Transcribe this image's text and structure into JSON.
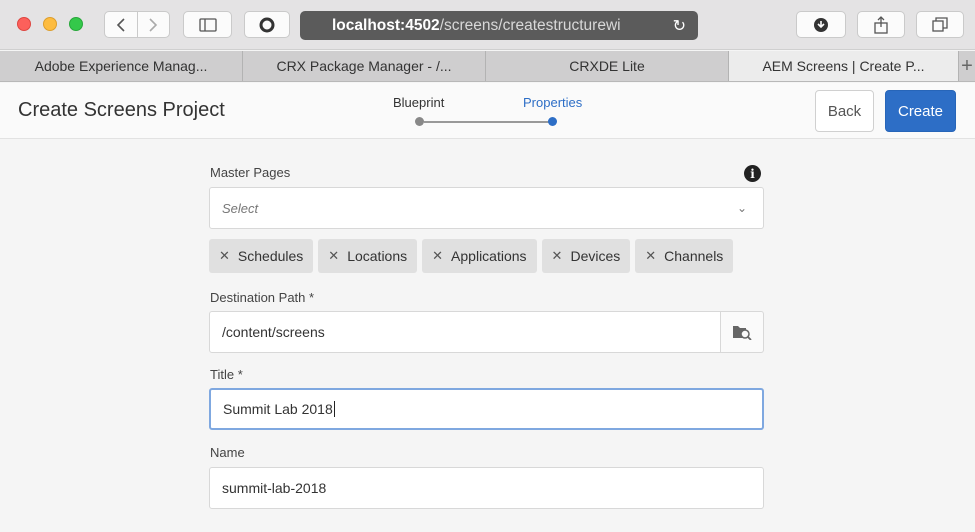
{
  "browser": {
    "url_host": "localhost:4502",
    "url_path": "/screens/createstructurewi",
    "tabs": [
      {
        "label": "Adobe Experience Manag..."
      },
      {
        "label": "CRX Package Manager - /..."
      },
      {
        "label": "CRXDE Lite"
      },
      {
        "label": "AEM Screens | Create P..."
      }
    ],
    "new_tab_label": "+"
  },
  "header": {
    "title": "Create Screens Project",
    "steps": [
      {
        "label": "Blueprint",
        "state": "done"
      },
      {
        "label": "Properties",
        "state": "current"
      }
    ],
    "back_label": "Back",
    "create_label": "Create"
  },
  "form": {
    "master_pages": {
      "label": "Master Pages",
      "placeholder": "Select",
      "tags": [
        {
          "label": "Schedules"
        },
        {
          "label": "Locations"
        },
        {
          "label": "Applications"
        },
        {
          "label": "Devices"
        },
        {
          "label": "Channels"
        }
      ]
    },
    "destination": {
      "label": "Destination Path *",
      "value": "/content/screens"
    },
    "title": {
      "label": "Title *",
      "value": "Summit Lab 2018"
    },
    "name": {
      "label": "Name",
      "value": "summit-lab-2018"
    }
  },
  "colors": {
    "accent": "#2d6ec6",
    "tag_bg": "#e0e0e0"
  }
}
